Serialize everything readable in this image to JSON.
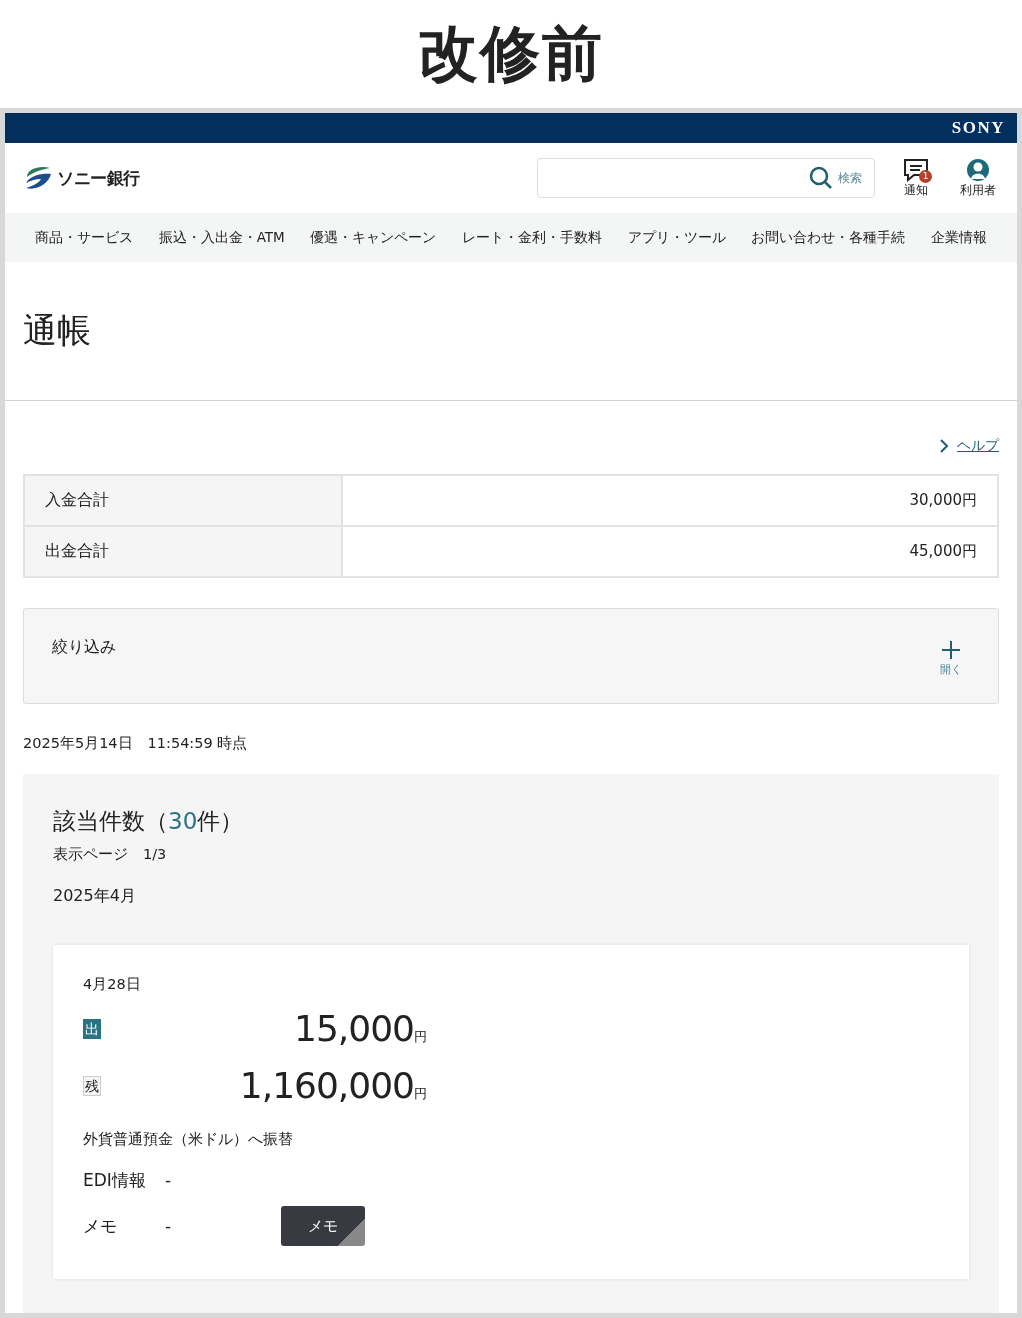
{
  "page_heading": "改修前",
  "brand_bar": {
    "logo": "SONY"
  },
  "header": {
    "bank_name": "ソニー銀行",
    "search": {
      "button_label": "検索"
    },
    "notifications": {
      "label": "通知",
      "badge": "1"
    },
    "user": {
      "label": "利用者"
    }
  },
  "nav": [
    "商品・サービス",
    "振込・入出金・ATM",
    "優遇・キャンペーン",
    "レート・金利・手数料",
    "アプリ・ツール",
    "お問い合わせ・各種手続",
    "企業情報"
  ],
  "title": "通帳",
  "help_link": "ヘルプ",
  "summary": [
    {
      "label": "入金合計",
      "value": "30,000円"
    },
    {
      "label": "出金合計",
      "value": "45,000円"
    }
  ],
  "filter": {
    "label": "絞り込み",
    "toggle_label": "開く",
    "expanded": false
  },
  "as_of": "2025年5月14日　11:54:59 時点",
  "results": {
    "count_prefix": "該当件数（",
    "count": "30",
    "count_suffix": "件）",
    "page_label": "表示ページ　1/3",
    "month": "2025年4月",
    "transactions": [
      {
        "date": "4月28日",
        "amounts": [
          {
            "kind": "withdrawal",
            "badge": "出",
            "value": "15,000",
            "unit": "円"
          },
          {
            "kind": "balance",
            "badge": "残",
            "value": "1,160,000",
            "unit": "円"
          }
        ],
        "description": "外貨普通預金（米ドル）へ振替",
        "fields": [
          {
            "label": "EDI情報",
            "value": "-"
          },
          {
            "label": "メモ",
            "value": "-"
          }
        ],
        "memo_button": "メモ"
      }
    ]
  }
}
